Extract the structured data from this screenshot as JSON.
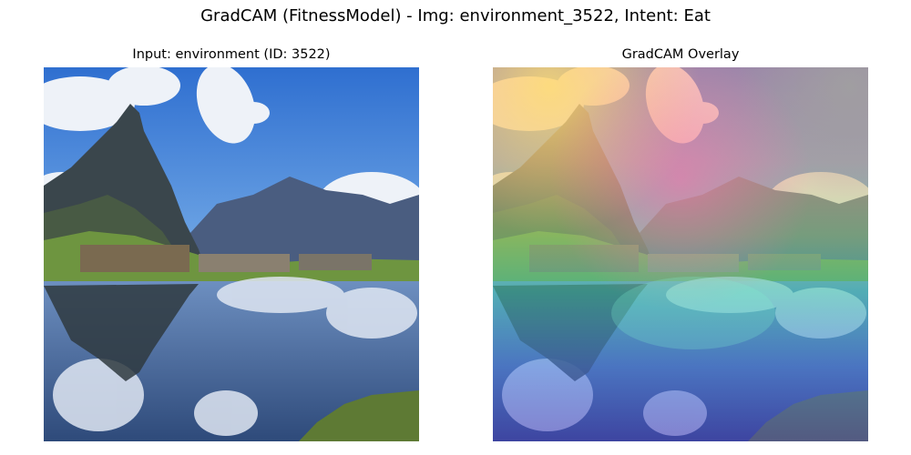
{
  "figure": {
    "suptitle": "GradCAM (FitnessModel) - Img: environment_3522, Intent: Eat"
  },
  "panels": [
    {
      "title": "Input: environment (ID: 3522)",
      "image": "mountain lake landscape photo"
    },
    {
      "title": "GradCAM Overlay",
      "image": "landscape photo with jet colormap heatmap overlay"
    }
  ],
  "colors": {
    "sky": "#3d7fd6",
    "cloud": "#f2f4f8",
    "mountain": "#3d4a52",
    "grass": "#6f9a3a",
    "water": "#4a6fa8",
    "heat_high": "#f08a8a",
    "heat_mid": "#5fd08a",
    "heat_low": "#5a5fd0"
  }
}
